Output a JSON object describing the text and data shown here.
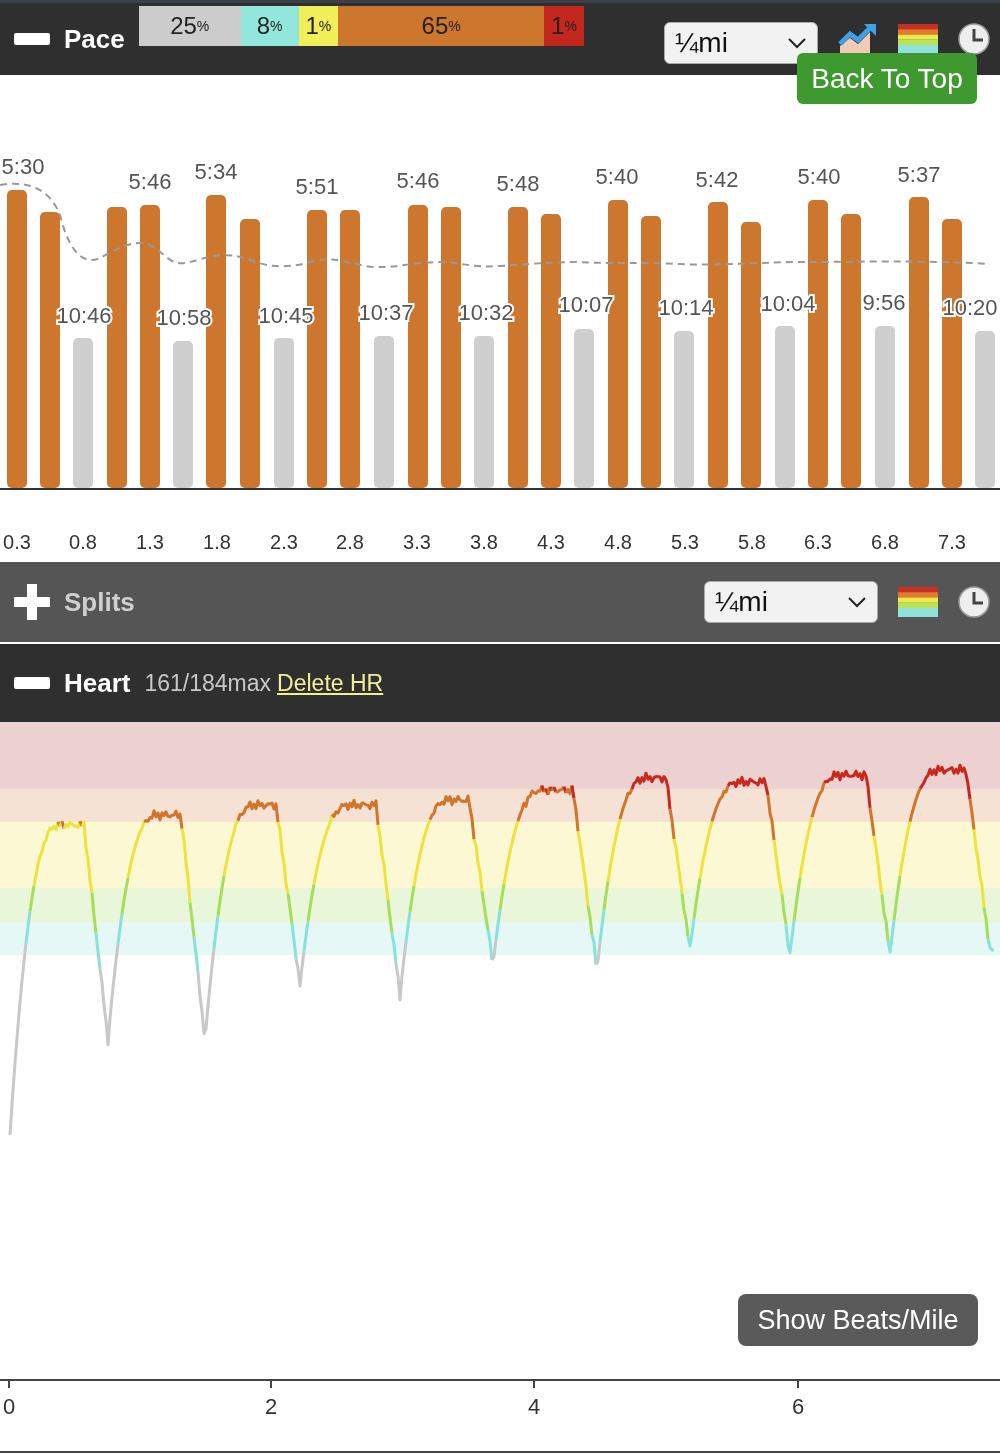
{
  "pace": {
    "title": "Pace",
    "expanded": true,
    "zones": [
      {
        "value": "25",
        "unit": "%",
        "color": "#cccccc"
      },
      {
        "value": "8",
        "unit": "%",
        "color": "#93e6dc"
      },
      {
        "value": "1",
        "unit": "%",
        "color": "#f2ee5a"
      },
      {
        "value": "65",
        "unit": "%",
        "color": "#cc762e"
      },
      {
        "value": "1",
        "unit": "%",
        "color": "#c3271e"
      }
    ],
    "unit_select": "¼mi",
    "fast_labels": [
      "5:30",
      "5:46",
      "5:34",
      "5:51",
      "5:46",
      "5:48",
      "5:40",
      "5:42",
      "5:40",
      "5:37"
    ],
    "slow_labels": [
      "10:46",
      "10:58",
      "10:45",
      "10:37",
      "10:32",
      "10:07",
      "10:14",
      "10:04",
      "9:56",
      "10:20"
    ],
    "x_labels": [
      "0.3",
      "0.8",
      "1.3",
      "1.8",
      "2.3",
      "2.8",
      "3.3",
      "3.8",
      "4.3",
      "4.8",
      "5.3",
      "5.8",
      "6.3",
      "6.8",
      "7.3"
    ]
  },
  "back_to_top": "Back To Top",
  "splits": {
    "title": "Splits",
    "expanded": false,
    "unit_select": "¼mi"
  },
  "heart": {
    "title": "Heart",
    "expanded": true,
    "summary": "161/184max",
    "link": "Delete HR",
    "x_labels": [
      "0",
      "2",
      "4",
      "6"
    ],
    "button": "Show Beats/Mile"
  }
}
